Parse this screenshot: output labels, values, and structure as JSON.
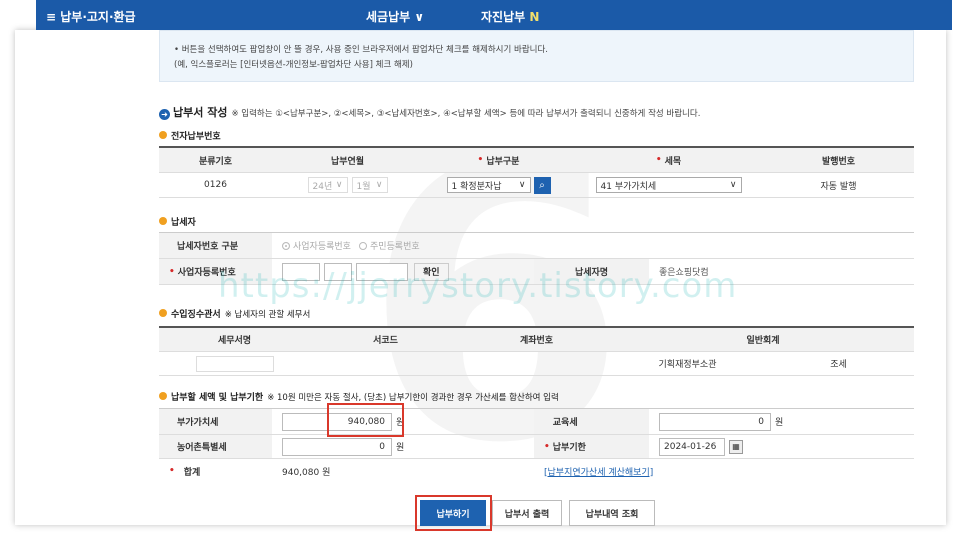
{
  "topbar": {
    "menu_left": "≡  납부·고지·환급",
    "menu_mid1": "세금납부",
    "menu_mid2": "자진납부",
    "new_badge": "N"
  },
  "notice": {
    "line1": "• 버튼을 선택하여도 팝업창이 안 뜰 경우, 사용 중인 브라우저에서 팝업차단 체크를 해제하시기 바랍니다.",
    "line2": "(예, 익스플로러는 [인터넷옵션-개인정보-팝업차단 사용] 체크 해제)"
  },
  "form_title": {
    "title": "납부서 작성",
    "note": "※ 입력하는 ①<납부구분>, ②<세목>, ③<납세자번호>, ④<납부할 세액> 등에 따라 납부서가 출력되니 신중하게 작성 바랍니다."
  },
  "electronic_no": {
    "title": "전자납부번호",
    "headers": [
      "분류기호",
      "납부연월",
      "납부구분",
      "세목",
      "발행번호"
    ],
    "class_code": "0126",
    "year": "24년",
    "month": "1월",
    "pay_type": "1 확정분자납",
    "tax_item": "41 부가가치세",
    "issue_no": "자동 발행"
  },
  "taxpayer": {
    "title": "납세자",
    "id_type_label": "납세자번호 구분",
    "option_business": "사업자등록번호",
    "option_resident": "주민등록번호",
    "bizno_label": "사업자등록번호",
    "confirm_button": "확인",
    "name_label": "납세자명",
    "name_value": "좋은쇼핑닷컴"
  },
  "office": {
    "title": "수입징수관서",
    "note": "※ 납세자의 관할 세무서",
    "headers": [
      "세무서명",
      "서코드",
      "계좌번호",
      "일반회계"
    ],
    "account_type": "기획재정부소관",
    "account_kind": "조세"
  },
  "amount": {
    "title": "납부할 세액 및 납부기한",
    "note": "※ 10원 미만은 자동 절사, (당초) 납부기한이 경과한 경우 가산세를 합산하여 입력",
    "vat_label": "부가가치세",
    "vat_value": "940,080",
    "unit": "원",
    "edu_label": "교육세",
    "edu_value": "0",
    "rural_label": "농어촌특별세",
    "rural_value": "0",
    "due_label": "납부기한",
    "due_value": "2024-01-26",
    "total_label": "합계",
    "total_value": "940,080 원",
    "late_link": "[납부지연가산세 계산해보기]"
  },
  "actions": {
    "pay": "납부하기",
    "print": "납부서 출력",
    "history": "납부내역 조회"
  },
  "watermark": {
    "digit": "6",
    "url": "https://jjerrystory.tistory.com"
  }
}
